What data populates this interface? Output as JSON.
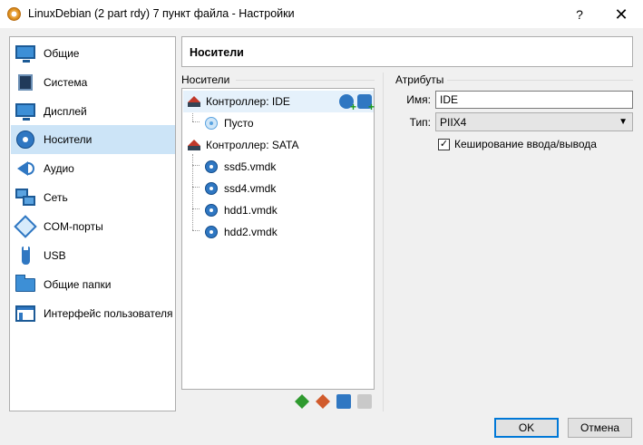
{
  "window": {
    "title": "LinuxDebian (2 part rdy) 7 пункт файла - Настройки",
    "help_label": "?",
    "close_label": "✕"
  },
  "sidebar": {
    "items": [
      {
        "label": "Общие",
        "icon": "general-icon"
      },
      {
        "label": "Система",
        "icon": "system-chip-icon"
      },
      {
        "label": "Дисплей",
        "icon": "display-icon"
      },
      {
        "label": "Носители",
        "icon": "storage-disc-icon",
        "selected": true
      },
      {
        "label": "Аудио",
        "icon": "audio-speaker-icon"
      },
      {
        "label": "Сеть",
        "icon": "network-icon"
      },
      {
        "label": "COM-порты",
        "icon": "serial-port-icon"
      },
      {
        "label": "USB",
        "icon": "usb-icon"
      },
      {
        "label": "Общие папки",
        "icon": "shared-folder-icon"
      },
      {
        "label": "Интерфейс пользователя",
        "icon": "user-interface-icon"
      }
    ]
  },
  "page": {
    "title": "Носители"
  },
  "storage": {
    "group_label": "Носители",
    "tree": [
      {
        "label": "Контроллер: IDE",
        "type": "controller"
      },
      {
        "label": "Пусто",
        "type": "optical"
      },
      {
        "label": "Контроллер: SATA",
        "type": "controller"
      },
      {
        "label": "ssd5.vmdk",
        "type": "hdd"
      },
      {
        "label": "ssd4.vmdk",
        "type": "hdd"
      },
      {
        "label": "hdd1.vmdk",
        "type": "hdd"
      },
      {
        "label": "hdd2.vmdk",
        "type": "hdd"
      }
    ]
  },
  "attributes": {
    "group_label": "Атрибуты",
    "name_label": "Имя:",
    "name_value": "IDE",
    "type_label": "Тип:",
    "type_value": "PIIX4",
    "cache_label": "Кеширование ввода/вывода",
    "cache_checked": true
  },
  "buttons": {
    "ok": "OK",
    "cancel": "Отмена"
  }
}
